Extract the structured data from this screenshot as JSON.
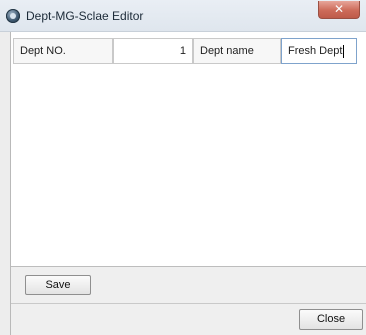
{
  "window": {
    "title": "Dept-MG-Sclae Editor",
    "close_glyph": "✕"
  },
  "form": {
    "dept_no_label": "Dept NO.",
    "dept_no_value": "1",
    "dept_name_label": "Dept name",
    "dept_name_value": "Fresh Dept"
  },
  "buttons": {
    "save": "Save",
    "close": "Close"
  },
  "icons": {
    "app": "app-logo-icon",
    "close": "close-icon"
  },
  "colors": {
    "titlebar": "#e4eaf1",
    "close_button": "#c9553f",
    "focus_border": "#7fa3cc"
  }
}
